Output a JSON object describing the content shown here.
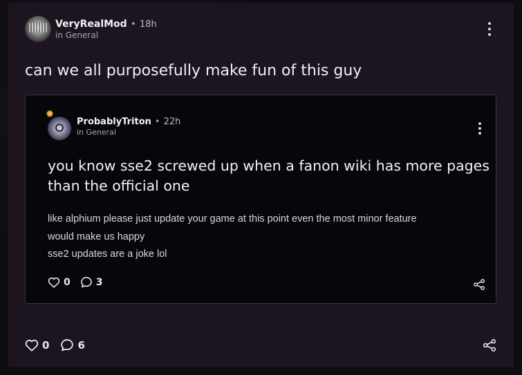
{
  "post": {
    "author": "VeryRealMod",
    "time": "18h",
    "separator": "•",
    "community": "in General",
    "title": "can we all purposefully make fun of this guy",
    "likes": "0",
    "comments": "6"
  },
  "embed": {
    "author": "ProbablyTriton",
    "time": "22h",
    "separator": "•",
    "community": "in General",
    "title": "you know sse2 screwed up when a fanon wiki has more pages than the official one",
    "body_lines": [
      "like alphium please just update your game at this point even the most minor feature",
      "would make us happy",
      "sse2 updates are a joke lol"
    ],
    "likes": "0",
    "comments": "3"
  },
  "icons": {
    "more": "more-vertical-icon",
    "like": "heart-icon",
    "comment": "comment-bubble-icon",
    "share": "share-icon",
    "badge": "star-badge-icon"
  },
  "colors": {
    "post_background": "#1c141f",
    "embed_background": "#07070b",
    "badge": "#f3b63a"
  }
}
